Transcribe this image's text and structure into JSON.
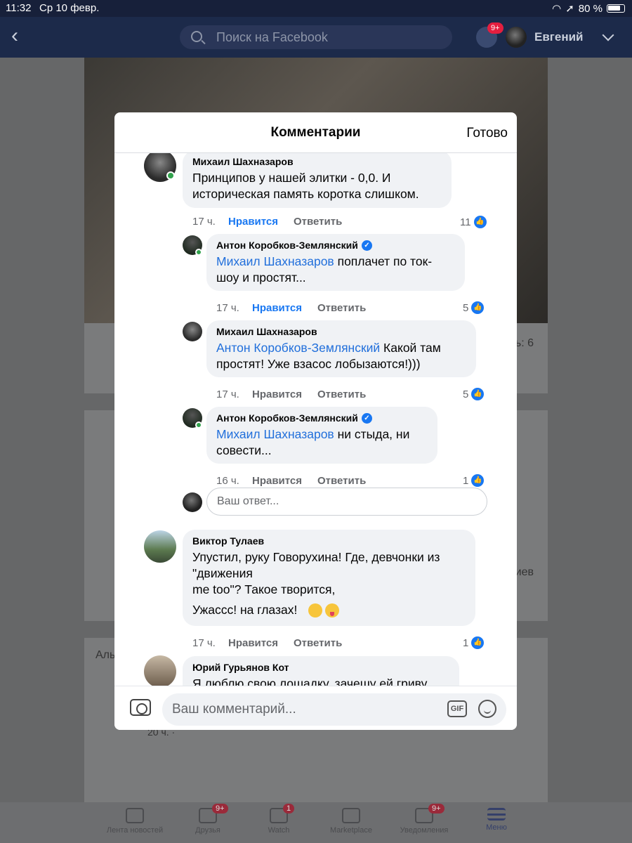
{
  "status_bar": {
    "time": "11:32",
    "date": "Ср 10 февр.",
    "battery": "80 %"
  },
  "top_nav": {
    "search_placeholder": "Поиск на Facebook",
    "messenger_badge": "9+",
    "user_name": "Евгений"
  },
  "background": {
    "count_text": "ь: 6",
    "views_text": "иев",
    "post_author_partial": "Аль",
    "post_time": "20 ч. ·"
  },
  "modal": {
    "title": "Комментарии",
    "done_label": "Готово",
    "reply_placeholder": "Ваш ответ...",
    "comment_placeholder": "Ваш комментарий...",
    "gif_label": "GIF",
    "like_label": "Нравится",
    "reply_label": "Ответить"
  },
  "comments": [
    {
      "author": "Михаил Шахназаров",
      "text": "Принципов у нашей элитки - 0,0. И\nисторическая память коротка слишком.",
      "time": "17 ч.",
      "likes": "11",
      "liked": true
    },
    {
      "author": "Антон Коробков-Землянский",
      "mention": "Михаил Шахназаров",
      "text": " поплачет по ток-\nшоу и простят...",
      "time": "17 ч.",
      "likes": "5",
      "liked": true,
      "verified": true
    },
    {
      "author": "Михаил Шахназаров",
      "mention": "Антон Коробков-Землянский",
      "text": " Какой там\nпростят! Уже взасос лобызаются!)))",
      "time": "17 ч.",
      "likes": "5",
      "liked": false
    },
    {
      "author": "Антон Коробков-Землянский",
      "mention": "Михаил Шахназаров",
      "text": " ни стыда, ни\nсовести...",
      "time": "16 ч.",
      "likes": "1",
      "liked": false,
      "verified": true
    },
    {
      "author": "Виктор Тулаев",
      "text": "Упустил, руку Говорухина! Где, девчонки из\n\"движения\nme too\"?  Такое творится,",
      "text2": "Ужассс! на глазах!",
      "time": "17 ч.",
      "likes": "1",
      "liked": false
    },
    {
      "author": "Юрий Гурьянов Кот",
      "text": "Я люблю свою лошадку, зачешу ей гриву"
    }
  ],
  "bottom_tabs": [
    {
      "label": "Лента новостей",
      "badge": ""
    },
    {
      "label": "Друзья",
      "badge": "9+"
    },
    {
      "label": "Watch",
      "badge": "1"
    },
    {
      "label": "Marketplace",
      "badge": ""
    },
    {
      "label": "Уведомления",
      "badge": "9+"
    },
    {
      "label": "Меню",
      "badge": ""
    }
  ]
}
